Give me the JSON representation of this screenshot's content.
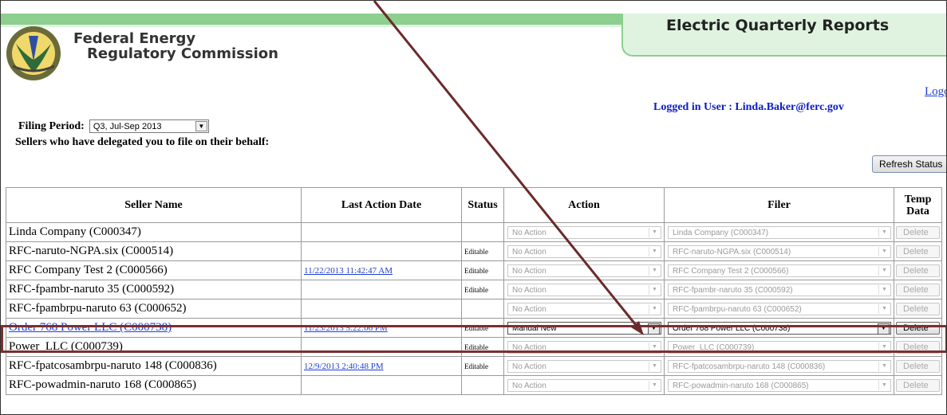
{
  "header": {
    "app_title": "Electric Quarterly Reports",
    "agency_line1": "Federal Energy",
    "agency_line2": "Regulatory Commission",
    "logout": "Logout",
    "logged_in": "Logged in User : Linda.Baker@ferc.gov"
  },
  "filing": {
    "label": "Filing Period:",
    "selected": "Q3, Jul-Sep 2013",
    "sellers_label": "Sellers who have delegated you to file on their behalf:",
    "refresh": "Refresh Status"
  },
  "table": {
    "headers": {
      "seller": "Seller Name",
      "date": "Last Action Date",
      "status": "Status",
      "action": "Action",
      "filer": "Filer",
      "temp1": "Temp",
      "temp2": "Data"
    },
    "rows": [
      {
        "seller": "Linda Company (C000347)",
        "date": "",
        "status": "",
        "action": "No Action",
        "filer": "Linda Company (C000347)",
        "delete": "Delete"
      },
      {
        "seller": "RFC-naruto-NGPA.six (C000514)",
        "date": "",
        "status": "Editable",
        "action": "No Action",
        "filer": "RFC-naruto-NGPA.six (C000514)",
        "delete": "Delete"
      },
      {
        "seller": "RFC Company Test 2 (C000566)",
        "date": "11/22/2013 11:42:47 AM",
        "status": "Editable",
        "action": "No Action",
        "filer": "RFC Company Test 2 (C000566)",
        "delete": "Delete"
      },
      {
        "seller": "RFC-fpambr-naruto 35 (C000592)",
        "date": "",
        "status": "Editable",
        "action": "No Action",
        "filer": "RFC-fpambr-naruto 35 (C000592)",
        "delete": "Delete"
      },
      {
        "seller": "RFC-fpambrpu-naruto 63 (C000652)",
        "date": "",
        "status": "",
        "action": "No Action",
        "filer": "RFC-fpambrpu-naruto 63 (C000652)",
        "delete": "Delete"
      },
      {
        "seller": "Order 768 Power LLC (C000738)",
        "date": "11/23/2013 5:22:06 PM",
        "status": "Editable",
        "action": "Manual New",
        "filer": "Order 768 Power LLC (C000738)",
        "delete": "Delete"
      },
      {
        "seller": "Power_LLC (C000739)",
        "date": "",
        "status": "Editable",
        "action": "No Action",
        "filer": "Power_LLC (C000739)",
        "delete": "Delete"
      },
      {
        "seller": "RFC-fpatcosambrpu-naruto 148 (C000836)",
        "date": "12/9/2013 2:40:48 PM",
        "status": "Editable",
        "action": "No Action",
        "filer": "RFC-fpatcosambrpu-naruto 148 (C000836)",
        "delete": "Delete"
      },
      {
        "seller": "RFC-powadmin-naruto 168 (C000865)",
        "date": "",
        "status": "",
        "action": "No Action",
        "filer": "RFC-powadmin-naruto 168 (C000865)",
        "delete": "Delete"
      }
    ]
  },
  "colors": {
    "header_green": "#8ccf8f",
    "link_blue": "#1f3fcf",
    "user_blue": "#0b1bc5",
    "highlight": "#7b2f2f"
  }
}
